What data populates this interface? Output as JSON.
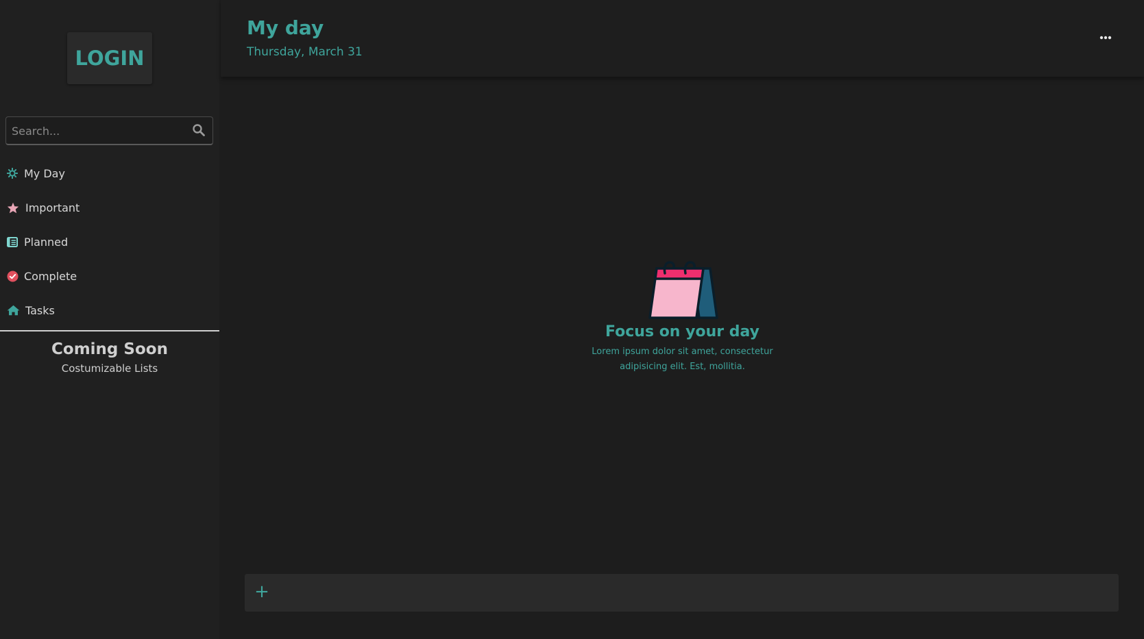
{
  "sidebar": {
    "login_label": "LOGIN",
    "search": {
      "placeholder": "Search...",
      "value": ""
    },
    "nav": [
      {
        "label": "My Day",
        "icon": "sun-icon",
        "color": "#3fa59c"
      },
      {
        "label": "Important",
        "icon": "star-icon",
        "color": "#e8a6b6"
      },
      {
        "label": "Planned",
        "icon": "calendar-list-icon",
        "color": "#7fd6cf"
      },
      {
        "label": "Complete",
        "icon": "check-circle-icon",
        "color": "#e0505e"
      },
      {
        "label": "Tasks",
        "icon": "home-icon",
        "color": "#3fa59c"
      }
    ],
    "coming_soon": {
      "title": "Coming Soon",
      "subtitle": "Costumizable Lists"
    }
  },
  "header": {
    "title": "My day",
    "date": "Thursday, March 31",
    "more_icon": "ellipsis-icon"
  },
  "empty_state": {
    "illustration": "calendar-illustration",
    "title": "Focus on your day",
    "text": "Lorem ipsum dolor sit amet, consectetur adipisicing elit. Est, mollitia."
  },
  "add_task": {
    "icon": "plus-icon",
    "symbol": "+",
    "value": ""
  },
  "colors": {
    "accent": "#3fa59c",
    "background": "#1d1d1d",
    "sidebar": "#202020",
    "surface": "#2a2a2a"
  }
}
